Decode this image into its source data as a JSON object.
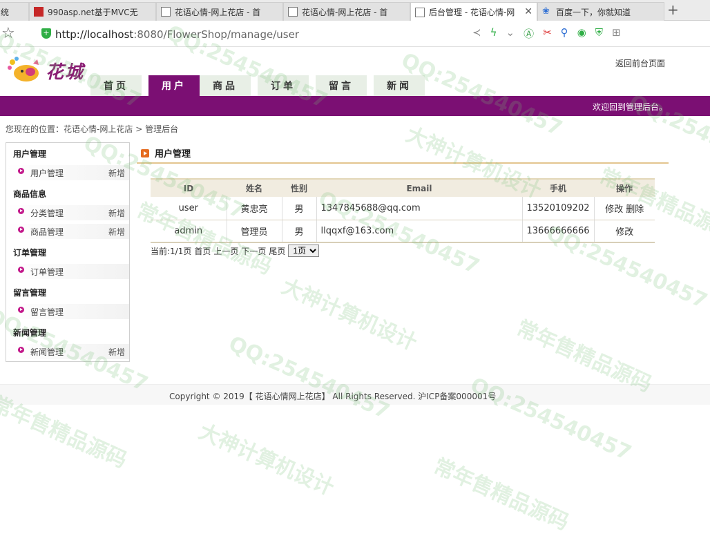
{
  "browser": {
    "tabs": [
      {
        "label": "990asp.net基于MVC无",
        "icon": "red-square-icon"
      },
      {
        "label": "花语心情-网上花店 - 首",
        "icon": "image-icon"
      },
      {
        "label": "花语心情-网上花店 - 首",
        "icon": "image-icon"
      },
      {
        "label": "后台管理 - 花语心情-网",
        "icon": "image-icon",
        "active": true
      },
      {
        "label": "百度一下，你就知道",
        "icon": "paw-icon"
      }
    ],
    "url_host": "http://localhost",
    "url_rest": ":8080/FlowerShop/manage/user"
  },
  "site": {
    "logo_text": "花城",
    "back_link": "返回前台页面",
    "nav": [
      "首页",
      "用户",
      "商品",
      "订单",
      "留言",
      "新闻"
    ],
    "active_nav": "用户",
    "welcome": "欢迎回到管理后台。",
    "breadcrumb": {
      "prefix": "您现在的位置：",
      "home": "花语心情-网上花店",
      "sep": ">",
      "current": "管理后台"
    }
  },
  "sidebar": {
    "sections": [
      {
        "title": "用户管理",
        "items": [
          {
            "label": "用户管理",
            "add": "新增"
          }
        ]
      },
      {
        "title": "商品信息",
        "items": [
          {
            "label": "分类管理",
            "add": "新增"
          },
          {
            "label": "商品管理",
            "add": "新增"
          }
        ]
      },
      {
        "title": "订单管理",
        "items": [
          {
            "label": "订单管理",
            "add": ""
          }
        ]
      },
      {
        "title": "留言管理",
        "items": [
          {
            "label": "留言管理",
            "add": ""
          }
        ]
      },
      {
        "title": "新闻管理",
        "items": [
          {
            "label": "新闻管理",
            "add": "新增"
          }
        ]
      }
    ]
  },
  "main": {
    "section_title": "用户管理",
    "columns": [
      "ID",
      "姓名",
      "性别",
      "Email",
      "手机",
      "操作"
    ],
    "rows": [
      {
        "id": "user",
        "name": "黄忠亮",
        "gender": "男",
        "email": "1347845688@qq.com",
        "phone": "13520109202",
        "edit": "修改",
        "delete": "删除"
      },
      {
        "id": "admin",
        "name": "管理员",
        "gender": "男",
        "email": "llqqxf@163.com",
        "phone": "13666666666",
        "edit": "修改",
        "delete": ""
      }
    ],
    "pager": {
      "current": "当前:1/1页",
      "first": "首页",
      "prev": "上一页",
      "next": "下一页",
      "last": "尾页",
      "select_value": "1页"
    }
  },
  "footer": {
    "text": "Copyright © 2019【 花语心情网上花店】 All Rights Reserved. 沪ICP备案000001号"
  },
  "watermark": {
    "qq": "QQ:254540457",
    "line1": "大神计算机设计",
    "line2": "常年售精品源码"
  }
}
